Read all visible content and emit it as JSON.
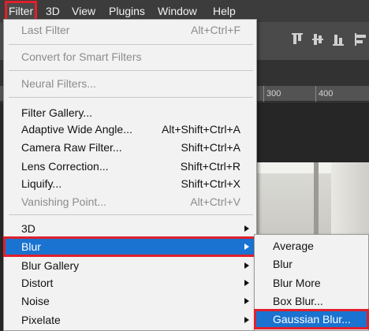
{
  "menubar": {
    "items": [
      {
        "label": "Filter",
        "active": true
      },
      {
        "label": "3D"
      },
      {
        "label": "View"
      },
      {
        "label": "Plugins"
      },
      {
        "label": "Window"
      },
      {
        "label": "Help"
      }
    ]
  },
  "ruler": {
    "ticks": [
      "300",
      "400"
    ]
  },
  "filter_menu": {
    "items": [
      {
        "label": "Last Filter",
        "shortcut": "Alt+Ctrl+F",
        "disabled": true
      },
      {
        "label": "Convert for Smart Filters",
        "disabled": true
      },
      {
        "label": "Neural Filters...",
        "disabled": true
      },
      {
        "label": "Filter Gallery..."
      },
      {
        "label": "Adaptive Wide Angle...",
        "shortcut": "Alt+Shift+Ctrl+A"
      },
      {
        "label": "Camera Raw Filter...",
        "shortcut": "Shift+Ctrl+A"
      },
      {
        "label": "Lens Correction...",
        "shortcut": "Shift+Ctrl+R"
      },
      {
        "label": "Liquify...",
        "shortcut": "Shift+Ctrl+X"
      },
      {
        "label": "Vanishing Point...",
        "shortcut": "Alt+Ctrl+V",
        "disabled": true
      },
      {
        "label": "3D",
        "submenu": true
      },
      {
        "label": "Blur",
        "submenu": true,
        "highlighted": true
      },
      {
        "label": "Blur Gallery",
        "submenu": true
      },
      {
        "label": "Distort",
        "submenu": true
      },
      {
        "label": "Noise",
        "submenu": true
      },
      {
        "label": "Pixelate",
        "submenu": true
      }
    ]
  },
  "blur_submenu": {
    "items": [
      {
        "label": "Average"
      },
      {
        "label": "Blur"
      },
      {
        "label": "Blur More"
      },
      {
        "label": "Box Blur..."
      },
      {
        "label": "Gaussian Blur...",
        "highlighted": true
      }
    ]
  },
  "colors": {
    "highlight_blue": "#1a73d0",
    "callout_red": "#e0202b",
    "menu_background": "#f2f2f2",
    "disabled_text": "#8c8c8c"
  },
  "icons": [
    "align-top-icon",
    "align-vertical-center-icon",
    "align-bottom-icon",
    "align-left-icon",
    "submenu-arrow-icon"
  ]
}
